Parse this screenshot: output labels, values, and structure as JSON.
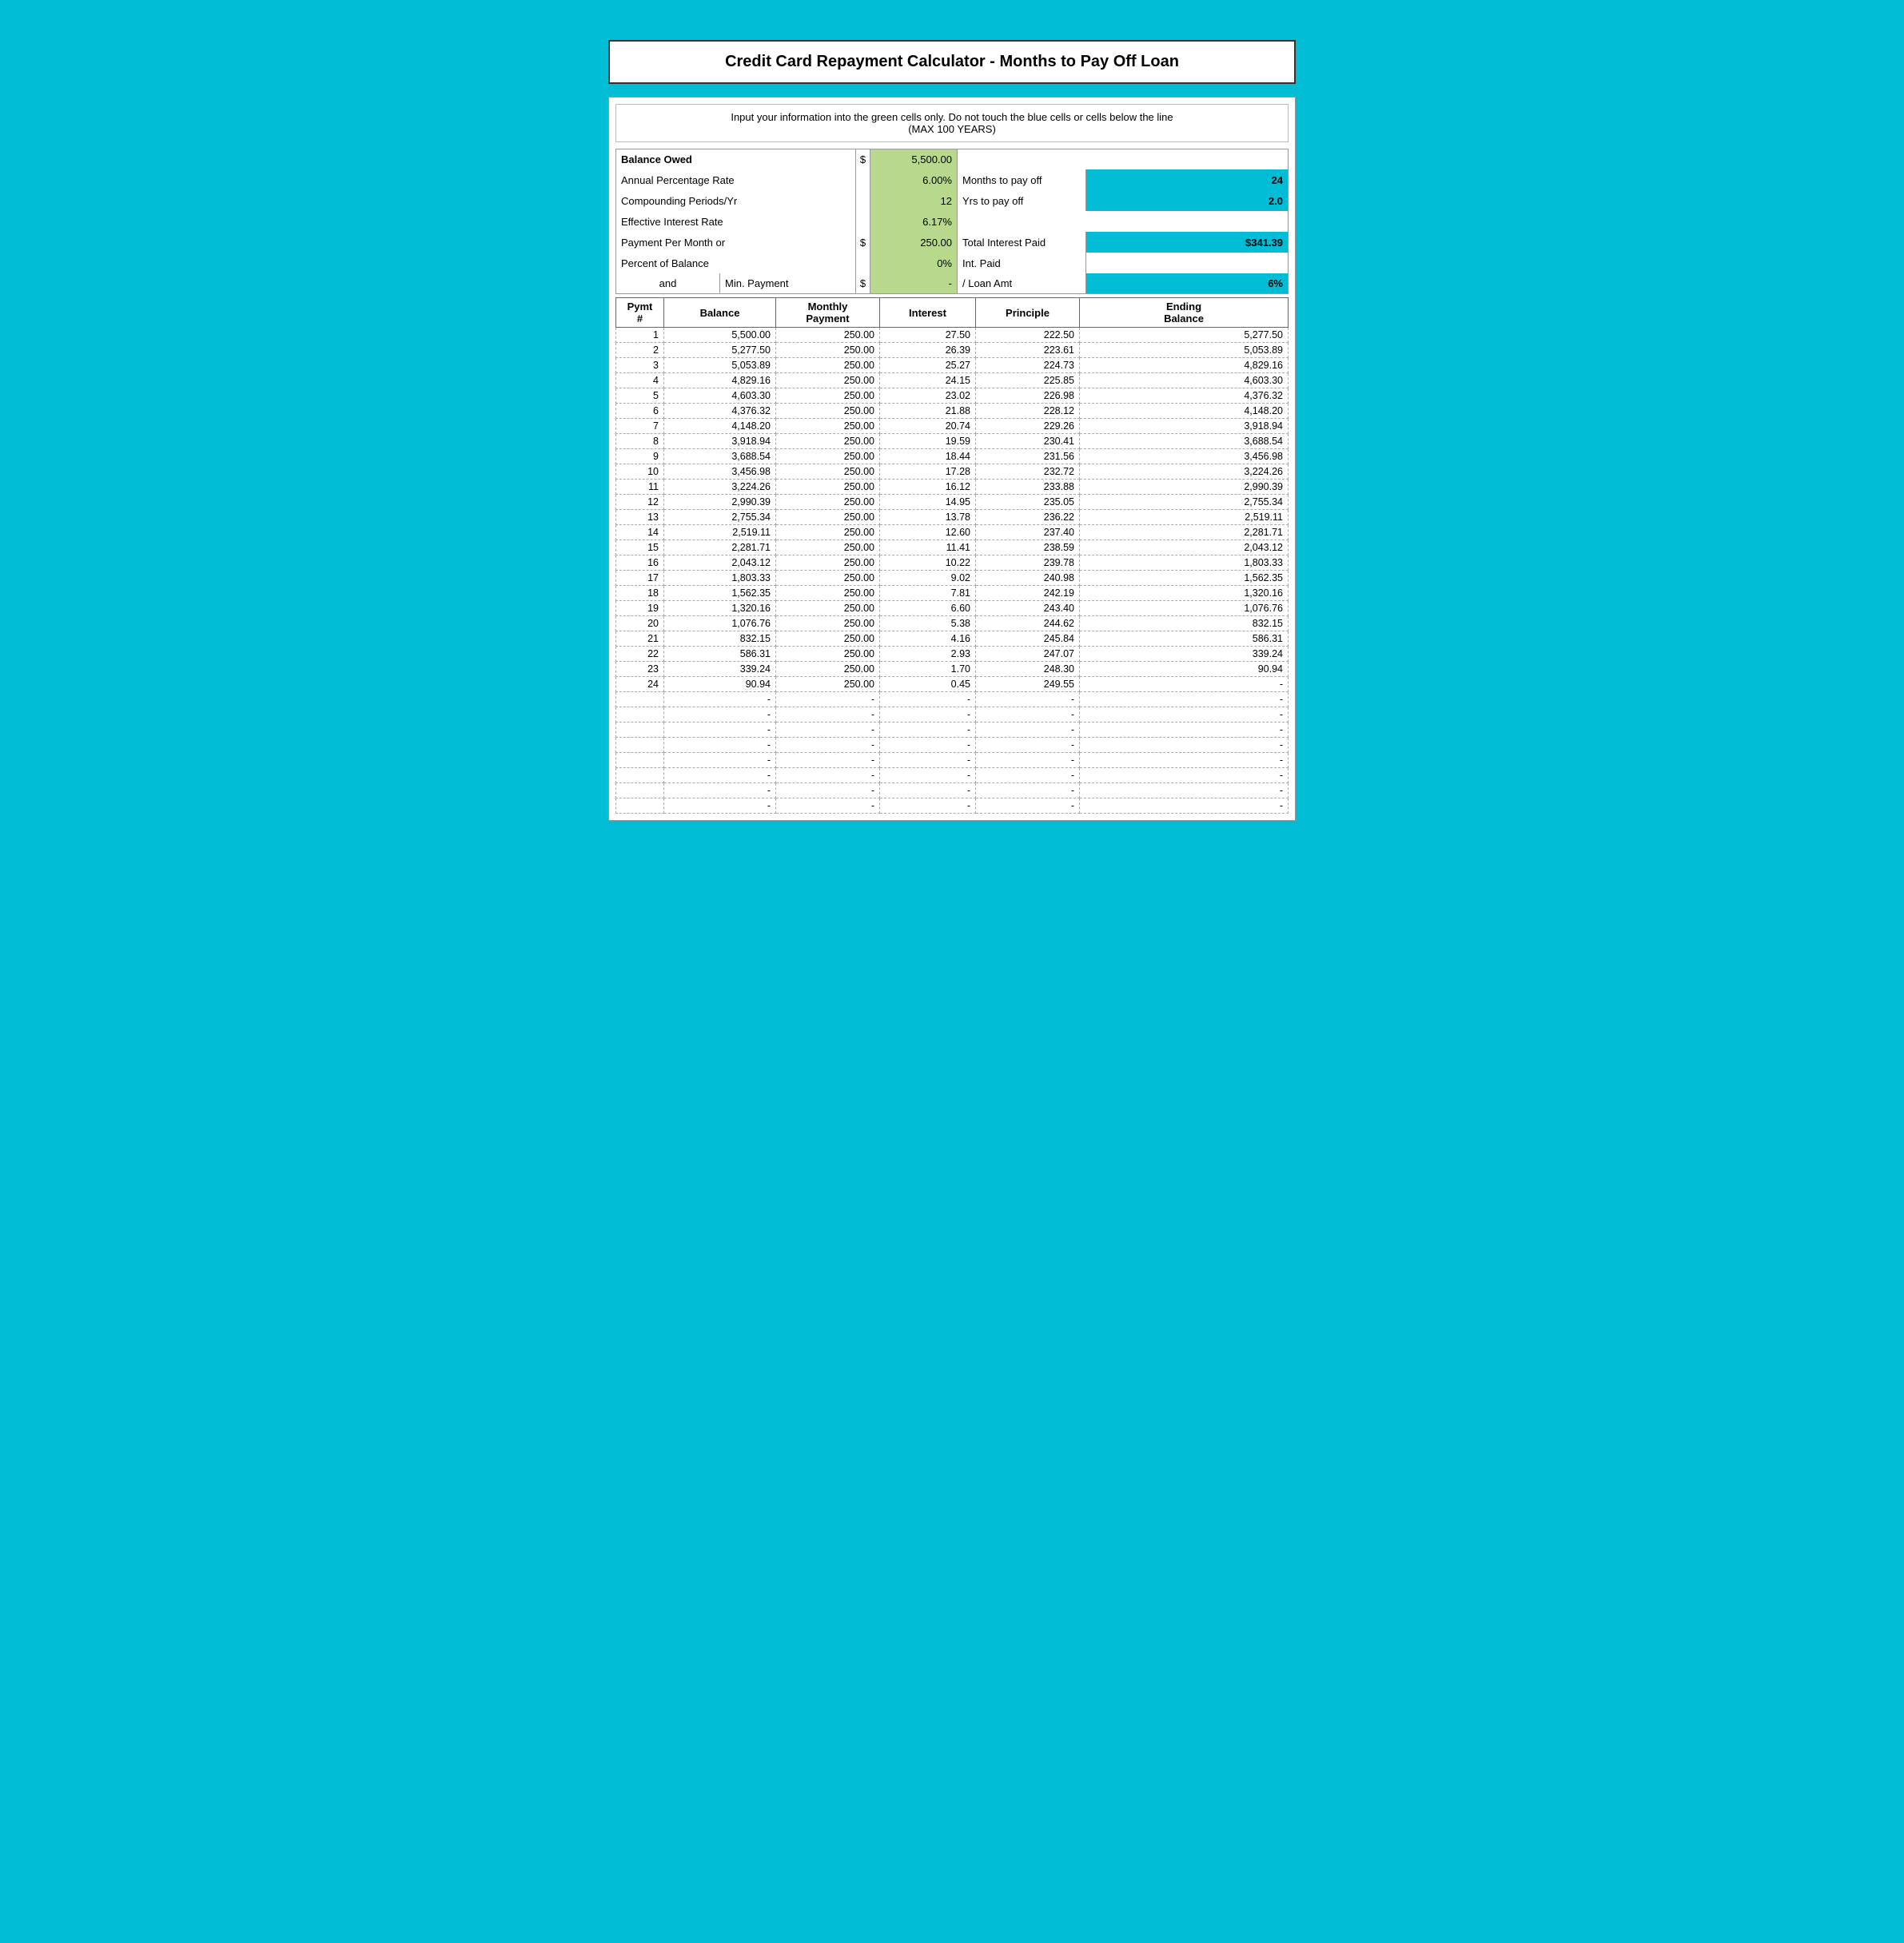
{
  "title": "Credit Card Repayment Calculator - Months to Pay Off Loan",
  "instruction_line1": "Input your information into the green cells only.  Do not touch the blue cells or cells below the line",
  "instruction_line2": "(MAX 100 YEARS)",
  "inputs": {
    "balance_owed_label": "Balance Owed",
    "balance_owed_dollar": "$",
    "balance_owed_value": "5,500.00",
    "apr_label": "Annual Percentage Rate",
    "apr_value": "6.00%",
    "months_to_pay_off_label": "Months to pay off",
    "months_to_pay_off_value": "24",
    "compounding_label": "Compounding Periods/Yr",
    "compounding_value": "12",
    "yrs_to_pay_off_label": "Yrs to pay off",
    "yrs_to_pay_off_value": "2.0",
    "effective_rate_label": "Effective Interest Rate",
    "effective_rate_value": "6.17%",
    "payment_per_month_label": "Payment Per Month or",
    "payment_per_month_dollar": "$",
    "payment_per_month_value": "250.00",
    "total_interest_label": "Total Interest Paid",
    "total_interest_value": "$341.39",
    "percent_of_balance_label": "Percent of Balance",
    "percent_of_balance_value": "0%",
    "int_paid_label": "Int. Paid",
    "and_label": "and",
    "min_payment_label": "Min. Payment",
    "min_payment_dollar": "$",
    "min_payment_value": "-",
    "loan_amt_label": "/ Loan Amt",
    "loan_amt_value": "6%"
  },
  "table_headers": {
    "pymt_num": "Pymt\n#",
    "balance": "Balance",
    "monthly_payment": "Monthly\nPayment",
    "interest": "Interest",
    "principle": "Principle",
    "ending_balance": "Ending\nBalance"
  },
  "rows": [
    {
      "num": "1",
      "balance": "5,500.00",
      "payment": "250.00",
      "interest": "27.50",
      "principle": "222.50",
      "ending": "5,277.50"
    },
    {
      "num": "2",
      "balance": "5,277.50",
      "payment": "250.00",
      "interest": "26.39",
      "principle": "223.61",
      "ending": "5,053.89"
    },
    {
      "num": "3",
      "balance": "5,053.89",
      "payment": "250.00",
      "interest": "25.27",
      "principle": "224.73",
      "ending": "4,829.16"
    },
    {
      "num": "4",
      "balance": "4,829.16",
      "payment": "250.00",
      "interest": "24.15",
      "principle": "225.85",
      "ending": "4,603.30"
    },
    {
      "num": "5",
      "balance": "4,603.30",
      "payment": "250.00",
      "interest": "23.02",
      "principle": "226.98",
      "ending": "4,376.32"
    },
    {
      "num": "6",
      "balance": "4,376.32",
      "payment": "250.00",
      "interest": "21.88",
      "principle": "228.12",
      "ending": "4,148.20"
    },
    {
      "num": "7",
      "balance": "4,148.20",
      "payment": "250.00",
      "interest": "20.74",
      "principle": "229.26",
      "ending": "3,918.94"
    },
    {
      "num": "8",
      "balance": "3,918.94",
      "payment": "250.00",
      "interest": "19.59",
      "principle": "230.41",
      "ending": "3,688.54"
    },
    {
      "num": "9",
      "balance": "3,688.54",
      "payment": "250.00",
      "interest": "18.44",
      "principle": "231.56",
      "ending": "3,456.98"
    },
    {
      "num": "10",
      "balance": "3,456.98",
      "payment": "250.00",
      "interest": "17.28",
      "principle": "232.72",
      "ending": "3,224.26"
    },
    {
      "num": "11",
      "balance": "3,224.26",
      "payment": "250.00",
      "interest": "16.12",
      "principle": "233.88",
      "ending": "2,990.39"
    },
    {
      "num": "12",
      "balance": "2,990.39",
      "payment": "250.00",
      "interest": "14.95",
      "principle": "235.05",
      "ending": "2,755.34"
    },
    {
      "num": "13",
      "balance": "2,755.34",
      "payment": "250.00",
      "interest": "13.78",
      "principle": "236.22",
      "ending": "2,519.11"
    },
    {
      "num": "14",
      "balance": "2,519.11",
      "payment": "250.00",
      "interest": "12.60",
      "principle": "237.40",
      "ending": "2,281.71"
    },
    {
      "num": "15",
      "balance": "2,281.71",
      "payment": "250.00",
      "interest": "11.41",
      "principle": "238.59",
      "ending": "2,043.12"
    },
    {
      "num": "16",
      "balance": "2,043.12",
      "payment": "250.00",
      "interest": "10.22",
      "principle": "239.78",
      "ending": "1,803.33"
    },
    {
      "num": "17",
      "balance": "1,803.33",
      "payment": "250.00",
      "interest": "9.02",
      "principle": "240.98",
      "ending": "1,562.35"
    },
    {
      "num": "18",
      "balance": "1,562.35",
      "payment": "250.00",
      "interest": "7.81",
      "principle": "242.19",
      "ending": "1,320.16"
    },
    {
      "num": "19",
      "balance": "1,320.16",
      "payment": "250.00",
      "interest": "6.60",
      "principle": "243.40",
      "ending": "1,076.76"
    },
    {
      "num": "20",
      "balance": "1,076.76",
      "payment": "250.00",
      "interest": "5.38",
      "principle": "244.62",
      "ending": "832.15"
    },
    {
      "num": "21",
      "balance": "832.15",
      "payment": "250.00",
      "interest": "4.16",
      "principle": "245.84",
      "ending": "586.31"
    },
    {
      "num": "22",
      "balance": "586.31",
      "payment": "250.00",
      "interest": "2.93",
      "principle": "247.07",
      "ending": "339.24"
    },
    {
      "num": "23",
      "balance": "339.24",
      "payment": "250.00",
      "interest": "1.70",
      "principle": "248.30",
      "ending": "90.94"
    },
    {
      "num": "24",
      "balance": "90.94",
      "payment": "250.00",
      "interest": "0.45",
      "principle": "249.55",
      "ending": "-"
    },
    {
      "num": "",
      "balance": "-",
      "payment": "-",
      "interest": "-",
      "principle": "-",
      "ending": "-"
    },
    {
      "num": "",
      "balance": "-",
      "payment": "-",
      "interest": "-",
      "principle": "-",
      "ending": "-"
    },
    {
      "num": "",
      "balance": "-",
      "payment": "-",
      "interest": "-",
      "principle": "-",
      "ending": "-"
    },
    {
      "num": "",
      "balance": "-",
      "payment": "-",
      "interest": "-",
      "principle": "-",
      "ending": "-"
    },
    {
      "num": "",
      "balance": "-",
      "payment": "-",
      "interest": "-",
      "principle": "-",
      "ending": "-"
    },
    {
      "num": "",
      "balance": "-",
      "payment": "-",
      "interest": "-",
      "principle": "-",
      "ending": "-"
    },
    {
      "num": "",
      "balance": "-",
      "payment": "-",
      "interest": "-",
      "principle": "-",
      "ending": "-"
    },
    {
      "num": "",
      "balance": "-",
      "payment": "-",
      "interest": "-",
      "principle": "-",
      "ending": "-"
    }
  ]
}
